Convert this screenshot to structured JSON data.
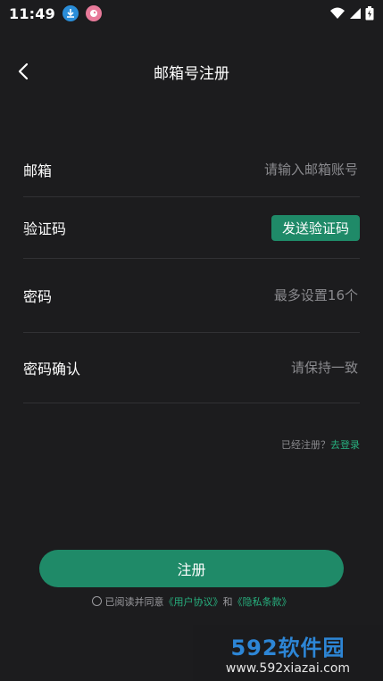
{
  "status_bar": {
    "time": "11:49",
    "icons": [
      "download-icon",
      "app-icon",
      "wifi-icon",
      "signal-icon",
      "battery-icon"
    ]
  },
  "nav": {
    "title": "邮箱号注册",
    "back_icon": "back-arrow-icon"
  },
  "form": {
    "email": {
      "label": "邮箱",
      "placeholder": "请输入邮箱账号"
    },
    "code": {
      "label": "验证码",
      "button": "发送验证码"
    },
    "password": {
      "label": "密码",
      "placeholder": "最多设置16个"
    },
    "confirm": {
      "label": "密码确认",
      "placeholder": "请保持一致"
    }
  },
  "login_hint": {
    "text": "已经注册？",
    "link": "去登录"
  },
  "register_button": "注册",
  "agreement": {
    "prefix": "已阅读并同意",
    "terms": "《用户协议》",
    "and": "和",
    "privacy": "《隐私条款》"
  },
  "watermark": {
    "logo": "592软件园",
    "url": "www.592xiazai.com"
  },
  "colors": {
    "accent": "#1f8a68",
    "link": "#27b07e",
    "background": "#1c1c1e"
  }
}
